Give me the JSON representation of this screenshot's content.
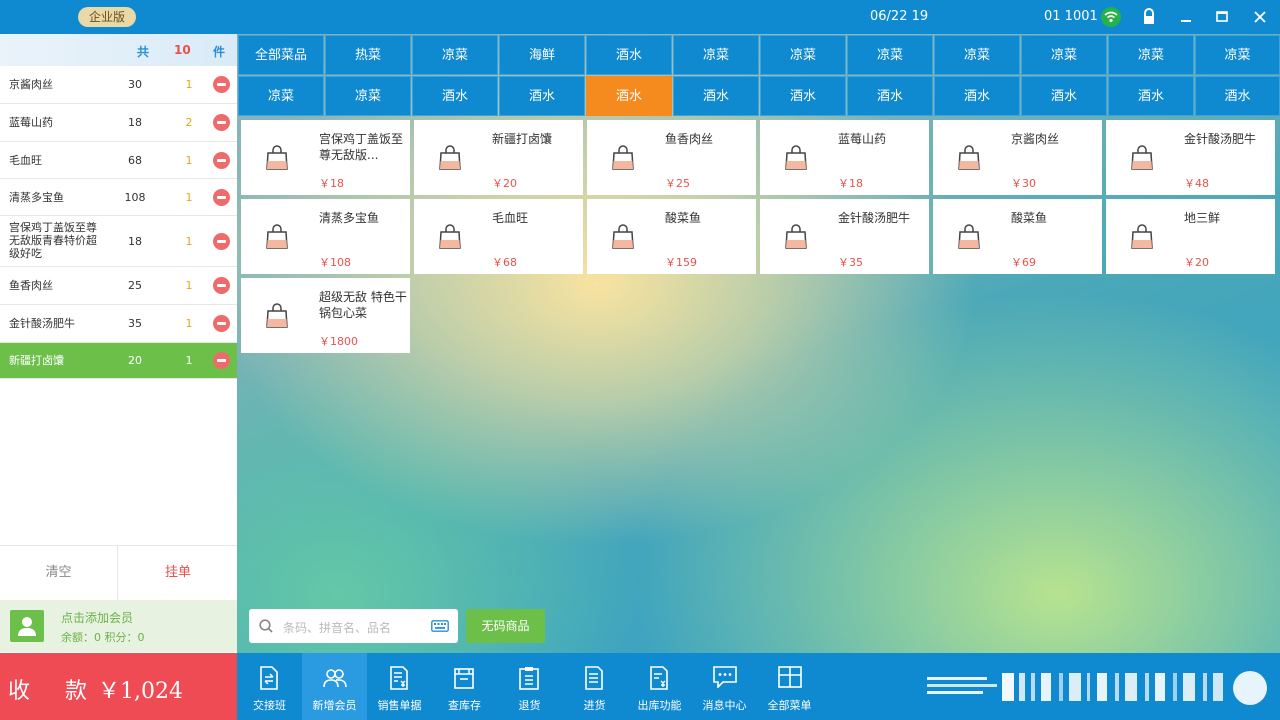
{
  "topbar": {
    "edition_badge": "企业版",
    "datetime": "06/22 19",
    "user": "01 1001",
    "icons": [
      "wifi-icon",
      "lock-icon",
      "minimize-icon",
      "maximize-icon",
      "close-icon"
    ]
  },
  "order": {
    "header": {
      "total_label": "共",
      "total_count": "10",
      "unit": "件"
    },
    "items": [
      {
        "name": "京酱肉丝",
        "price": "30",
        "qty": "1"
      },
      {
        "name": "蓝莓山药",
        "price": "18",
        "qty": "2"
      },
      {
        "name": "毛血旺",
        "price": "68",
        "qty": "1"
      },
      {
        "name": "清蒸多宝鱼",
        "price": "108",
        "qty": "1"
      },
      {
        "name": "宫保鸡丁盖饭至尊无敌版青春特价超级好吃",
        "price": "18",
        "qty": "1"
      },
      {
        "name": "鱼香肉丝",
        "price": "25",
        "qty": "1"
      },
      {
        "name": "金针酸汤肥牛",
        "price": "35",
        "qty": "1"
      },
      {
        "name": "新疆打卤馕",
        "price": "20",
        "qty": "1"
      }
    ],
    "clear_label": "清空",
    "hold_label": "挂单"
  },
  "member": {
    "add_label": "点击添加会员",
    "balance_text": "余额：0   积分：0"
  },
  "checkout": {
    "label_1": "收",
    "label_2": "款",
    "amount": "￥1,024"
  },
  "categories": {
    "row1": [
      "全部菜品",
      "热菜",
      "凉菜",
      "海鲜",
      "酒水",
      "凉菜",
      "凉菜",
      "凉菜",
      "凉菜",
      "凉菜",
      "凉菜",
      "凉菜"
    ],
    "row2": [
      "凉菜",
      "凉菜",
      "酒水",
      "酒水",
      "酒水",
      "酒水",
      "酒水",
      "酒水",
      "酒水",
      "酒水",
      "酒水",
      "酒水"
    ],
    "selected": "酒水"
  },
  "products": [
    {
      "name": "宫保鸡丁盖饭至尊无敌版...",
      "price": "￥18"
    },
    {
      "name": "新疆打卤馕",
      "price": "￥20"
    },
    {
      "name": "鱼香肉丝",
      "price": "￥25"
    },
    {
      "name": "蓝莓山药",
      "price": "￥18"
    },
    {
      "name": "京酱肉丝",
      "price": "￥30"
    },
    {
      "name": "金针酸汤肥牛",
      "price": "￥48"
    },
    {
      "name": "清蒸多宝鱼",
      "price": "￥108"
    },
    {
      "name": "毛血旺",
      "price": "￥68"
    },
    {
      "name": "酸菜鱼",
      "price": "￥159"
    },
    {
      "name": "金针酸汤肥牛",
      "price": "￥35"
    },
    {
      "name": "酸菜鱼",
      "price": "￥69"
    },
    {
      "name": "地三鲜",
      "price": "￥20"
    },
    {
      "name": "超级无敌 特色干锅包心菜",
      "price": "￥1800"
    }
  ],
  "search": {
    "placeholder": "条码、拼音名、品名",
    "nocode_label": "无码商品"
  },
  "bottom_nav": [
    {
      "label": "交接班",
      "icon": "handover-icon"
    },
    {
      "label": "新增会员",
      "icon": "add-member-icon"
    },
    {
      "label": "销售单据",
      "icon": "sales-receipt-icon"
    },
    {
      "label": "查库存",
      "icon": "inventory-icon"
    },
    {
      "label": "退货",
      "icon": "return-icon"
    },
    {
      "label": "进货",
      "icon": "purchase-icon"
    },
    {
      "label": "出库功能",
      "icon": "outbound-icon"
    },
    {
      "label": "消息中心",
      "icon": "message-icon"
    },
    {
      "label": "全部菜单",
      "icon": "all-menu-icon"
    }
  ],
  "colors": {
    "primary": "#0f8ad0",
    "accent_orange": "#f58a1f",
    "green": "#6cc04a",
    "red": "#ef4b55",
    "price_red": "#e8524a"
  }
}
